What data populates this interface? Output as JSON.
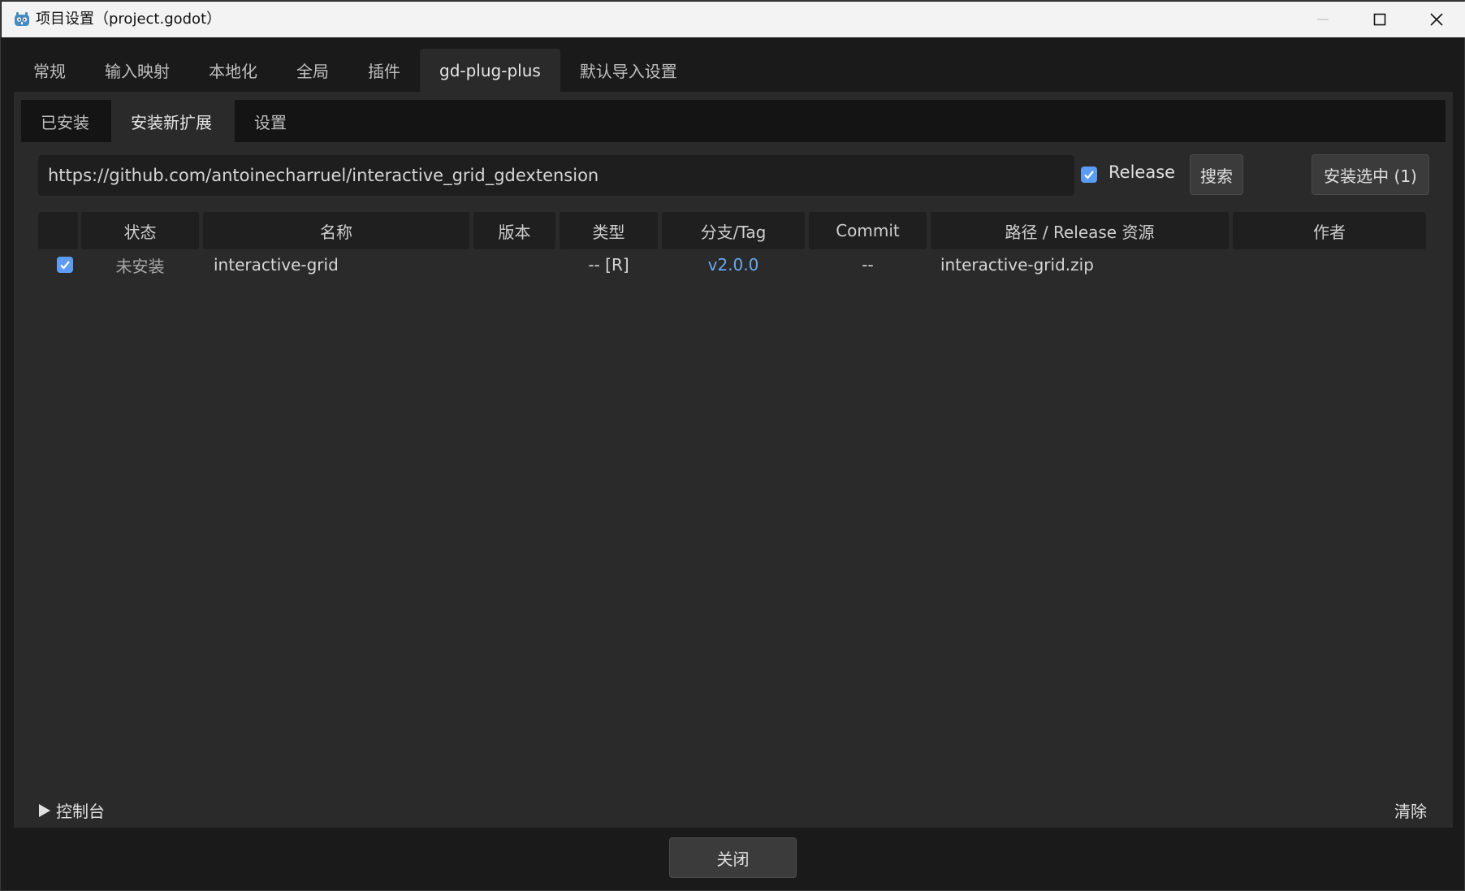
{
  "window": {
    "title": "项目设置（project.godot）"
  },
  "main_tabs": [
    {
      "label": "常规"
    },
    {
      "label": "输入映射"
    },
    {
      "label": "本地化"
    },
    {
      "label": "全局"
    },
    {
      "label": "插件"
    },
    {
      "label": "gd-plug-plus",
      "active": true
    },
    {
      "label": "默认导入设置"
    }
  ],
  "sub_tabs": [
    {
      "label": "已安装"
    },
    {
      "label": "安装新扩展",
      "active": true
    },
    {
      "label": "设置"
    }
  ],
  "search": {
    "url_value": "https://github.com/antoinecharruel/interactive_grid_gdextension",
    "release_checked": true,
    "release_label": "Release",
    "search_label": "搜索",
    "install_selected_label": "安装选中 (1)"
  },
  "table": {
    "columns": [
      "状态",
      "名称",
      "版本",
      "类型",
      "分支/Tag",
      "Commit",
      "路径 / Release 资源",
      "作者"
    ],
    "rows": [
      {
        "checked": true,
        "status": "未安装",
        "name": "interactive-grid",
        "version": "",
        "type": "-- [R]",
        "branch_tag": "v2.0.0",
        "commit": "--",
        "path": "interactive-grid.zip",
        "author": ""
      }
    ]
  },
  "footer": {
    "console_label": "控制台",
    "clear_label": "清除",
    "close_label": "关闭"
  },
  "colors": {
    "accent": "#5c9cf5",
    "link": "#6aa8f0",
    "background": "#1a1a1a",
    "panel": "#2a2a2a"
  }
}
